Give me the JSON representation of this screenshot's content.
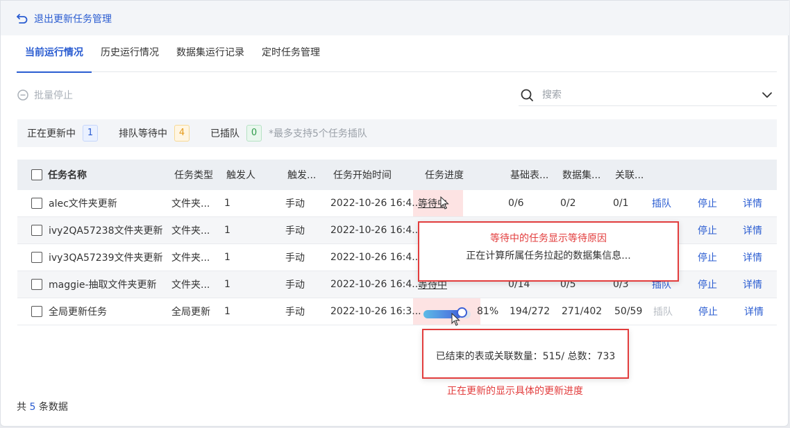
{
  "header": {
    "back_label": "退出更新任务管理"
  },
  "tabs": [
    {
      "label": "当前运行情况",
      "active": true
    },
    {
      "label": "历史运行情况",
      "active": false
    },
    {
      "label": "数据集运行记录",
      "active": false
    },
    {
      "label": "定时任务管理",
      "active": false
    }
  ],
  "toolbar": {
    "batch_stop_label": "批量停止",
    "search_placeholder": "搜索"
  },
  "status": {
    "updating_label": "正在更新中",
    "updating_count": "1",
    "queued_label": "排队等待中",
    "queued_count": "4",
    "inserted_label": "已插队",
    "inserted_count": "0",
    "note": "*最多支持5个任务插队"
  },
  "table": {
    "headers": {
      "name": "任务名称",
      "type": "任务类型",
      "trigger_user": "触发人",
      "trigger_mode": "触发...",
      "start_time": "任务开始时间",
      "progress": "任务进度",
      "base_table": "基础表...",
      "dataset": "数据集...",
      "relation": "关联..."
    },
    "rows": [
      {
        "name": "alec文件夹更新",
        "type": "文件夹...",
        "trigger_user": "1",
        "trigger_mode": "手动",
        "start_time": "2022-10-26 16:4...",
        "progress": "等待中",
        "base_table": "0/6",
        "dataset": "0/2",
        "relation": "0/1",
        "insert": "插队",
        "stop": "停止",
        "detail": "详情"
      },
      {
        "name": "ivy2QA57238文件夹更新",
        "type": "文件夹...",
        "trigger_user": "1",
        "trigger_mode": "手动",
        "start_time": "2022-10-26 16:4...",
        "progress": "",
        "base_table": "",
        "dataset": "",
        "relation": "",
        "insert": "",
        "stop": "停止",
        "detail": "详情"
      },
      {
        "name": "ivy3QA57239文件夹更新",
        "type": "文件夹...",
        "trigger_user": "1",
        "trigger_mode": "手动",
        "start_time": "2022-10-26 16:4...",
        "progress": "",
        "base_table": "",
        "dataset": "",
        "relation": "",
        "insert": "",
        "stop": "停止",
        "detail": "详情"
      },
      {
        "name": "maggie-抽取文件夹更新",
        "type": "文件夹...",
        "trigger_user": "1",
        "trigger_mode": "手动",
        "start_time": "2022-10-26 16:4...",
        "progress": "等待中",
        "base_table": "0/14",
        "dataset": "0/5",
        "relation": "0/3",
        "insert": "插队",
        "stop": "停止",
        "detail": "详情"
      },
      {
        "name": "全局更新任务",
        "type": "全局更新",
        "trigger_user": "1",
        "trigger_mode": "手动",
        "start_time": "2022-10-26 16:3...",
        "progress_pct": "81%",
        "progress_value": 0.81,
        "base_table": "194/272",
        "dataset": "271/402",
        "relation": "50/59",
        "insert": "插队",
        "stop": "停止",
        "detail": "详情"
      }
    ]
  },
  "tooltip_waiting": {
    "title": "等待中的任务显示等待原因",
    "body": "正在计算所属任务拉起的数据集信息..."
  },
  "tooltip_progress": {
    "body": "已结束的表或关联数量：515/ 总数：733"
  },
  "annotation_caption": "正在更新的显示具体的更新进度",
  "footer": {
    "prefix": "共",
    "count": "5",
    "suffix": "条数据"
  },
  "colors": {
    "accent": "#2a5cd1",
    "annotation_red": "#e23c3c"
  }
}
